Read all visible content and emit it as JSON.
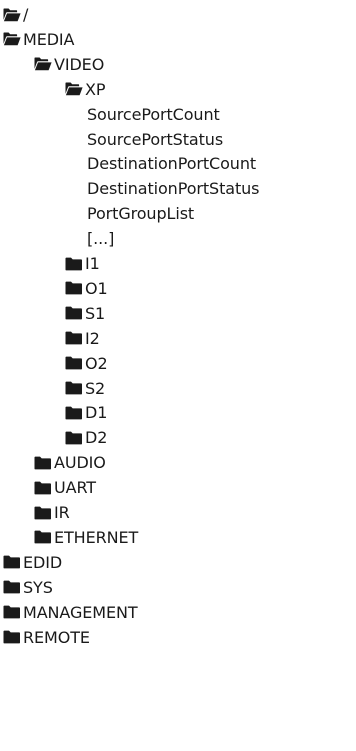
{
  "tree": [
    {
      "label": "/",
      "depth": 0,
      "icon": "folder-open-icon",
      "kind": "folder"
    },
    {
      "label": "MEDIA",
      "depth": 0,
      "icon": "folder-open-icon",
      "kind": "folder"
    },
    {
      "label": "VIDEO",
      "depth": 1,
      "icon": "folder-open-icon",
      "kind": "folder"
    },
    {
      "label": "XP",
      "depth": 2,
      "icon": "folder-open-icon",
      "kind": "folder"
    },
    {
      "label": "SourcePortCount",
      "depth": 3,
      "icon": "",
      "kind": "item"
    },
    {
      "label": "SourcePortStatus",
      "depth": 3,
      "icon": "",
      "kind": "item"
    },
    {
      "label": "DestinationPortCount",
      "depth": 3,
      "icon": "",
      "kind": "item"
    },
    {
      "label": "DestinationPortStatus",
      "depth": 3,
      "icon": "",
      "kind": "item"
    },
    {
      "label": "PortGroupList",
      "depth": 3,
      "icon": "",
      "kind": "item"
    },
    {
      "label": "[...]",
      "depth": 3,
      "icon": "",
      "kind": "item"
    },
    {
      "label": "I1",
      "depth": 2,
      "icon": "folder-closed-icon",
      "kind": "folder"
    },
    {
      "label": "O1",
      "depth": 2,
      "icon": "folder-closed-icon",
      "kind": "folder"
    },
    {
      "label": "S1",
      "depth": 2,
      "icon": "folder-closed-icon",
      "kind": "folder"
    },
    {
      "label": "I2",
      "depth": 2,
      "icon": "folder-closed-icon",
      "kind": "folder"
    },
    {
      "label": "O2",
      "depth": 2,
      "icon": "folder-closed-icon",
      "kind": "folder"
    },
    {
      "label": "S2",
      "depth": 2,
      "icon": "folder-closed-icon",
      "kind": "folder"
    },
    {
      "label": "D1",
      "depth": 2,
      "icon": "folder-closed-icon",
      "kind": "folder"
    },
    {
      "label": "D2",
      "depth": 2,
      "icon": "folder-closed-icon",
      "kind": "folder"
    },
    {
      "label": "AUDIO",
      "depth": 1,
      "icon": "folder-closed-icon",
      "kind": "folder"
    },
    {
      "label": "UART",
      "depth": 1,
      "icon": "folder-closed-icon",
      "kind": "folder"
    },
    {
      "label": "IR",
      "depth": 1,
      "icon": "folder-closed-icon",
      "kind": "folder"
    },
    {
      "label": "ETHERNET",
      "depth": 1,
      "icon": "folder-closed-icon",
      "kind": "folder"
    },
    {
      "label": "EDID",
      "depth": 0,
      "icon": "folder-closed-icon",
      "kind": "folder"
    },
    {
      "label": "SYS",
      "depth": 0,
      "icon": "folder-closed-icon",
      "kind": "folder"
    },
    {
      "label": "MANAGEMENT",
      "depth": 0,
      "icon": "folder-closed-icon",
      "kind": "folder"
    },
    {
      "label": "REMOTE",
      "depth": 0,
      "icon": "folder-closed-icon",
      "kind": "folder"
    }
  ],
  "colors": {
    "text": "#1a1a1a",
    "icon": "#1a1a1a",
    "background": "#ffffff"
  }
}
